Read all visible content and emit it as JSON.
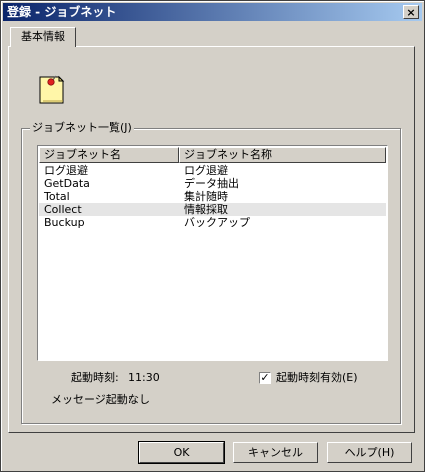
{
  "window": {
    "title": "登録 - ジョブネット",
    "close_label": "×"
  },
  "tabs": [
    {
      "label": "基本情報"
    }
  ],
  "group": {
    "legend": "ジョブネット一覧(J)"
  },
  "list": {
    "headers": [
      "ジョブネット名",
      "ジョブネット名称"
    ],
    "rows": [
      {
        "name": "ログ退避",
        "title": "ログ退避"
      },
      {
        "name": "GetData",
        "title": "データ抽出"
      },
      {
        "name": "Total",
        "title": "集計随時"
      },
      {
        "name": "Collect",
        "title": "情報採取"
      },
      {
        "name": "Buckup",
        "title": "バックアップ"
      }
    ],
    "selected_index": 3
  },
  "fields": {
    "start_time_label": "起動時刻:",
    "start_time_value": "11:30",
    "message_start_label": "メッセージ起動:",
    "message_start_value": "なし",
    "start_time_enabled_label": "起動時刻有効(E)",
    "start_time_enabled_checked": true,
    "check_mark": "✓"
  },
  "buttons": {
    "ok": "OK",
    "cancel": "キャンセル",
    "help": "ヘルプ(H)"
  }
}
